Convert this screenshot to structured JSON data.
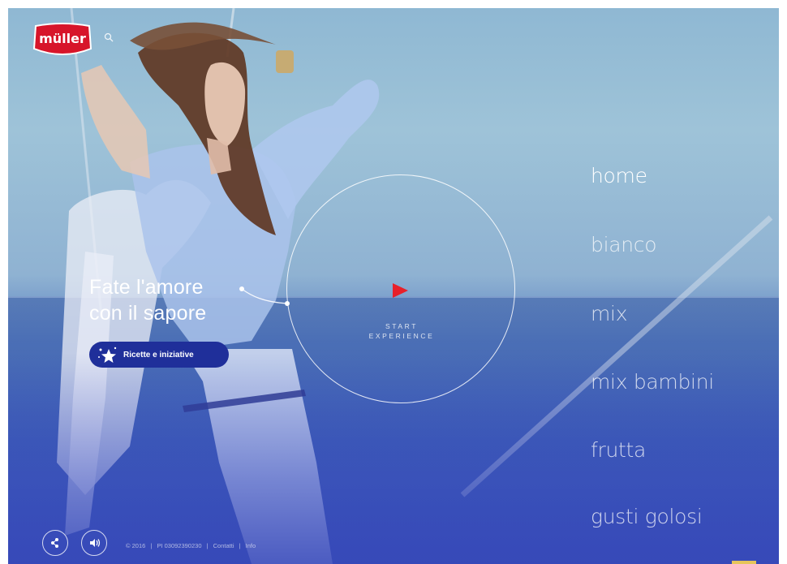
{
  "brand": {
    "logo_text": "müller",
    "logo_color": "#d7152a"
  },
  "hero": {
    "headline_line1": "Fate l'amore",
    "headline_line2": "con il sapore",
    "cta_label": "Ricette e iniziative",
    "cta_color": "#1f2f9a"
  },
  "player": {
    "start_line1": "START",
    "start_line2": "EXPERIENCE",
    "play_color": "#e8202a"
  },
  "nav": {
    "items": [
      {
        "label": "home",
        "active": true
      },
      {
        "label": "bianco",
        "active": false
      },
      {
        "label": "mix",
        "active": false
      },
      {
        "label": "mix bambini",
        "active": false
      },
      {
        "label": "frutta",
        "active": false
      },
      {
        "label": "gusti golosi",
        "active": false
      }
    ]
  },
  "footer": {
    "copyright": "© 2016",
    "vat": "PI 03092390230",
    "contacts": "Contatti",
    "info": "Info",
    "separator": "|"
  },
  "icons": [
    "search-icon",
    "share-icon",
    "sound-icon",
    "star-icon",
    "play-icon"
  ]
}
